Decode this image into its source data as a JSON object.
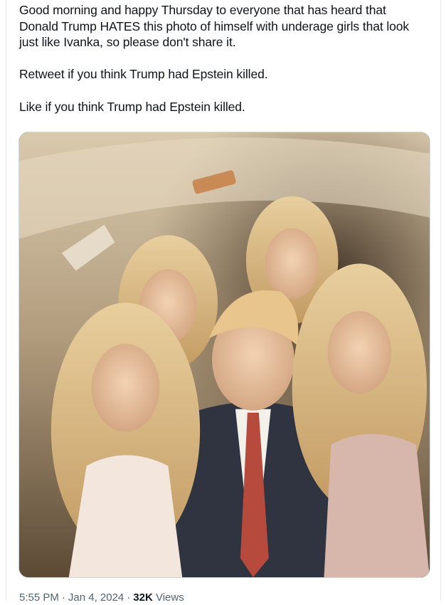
{
  "tweet": {
    "lines": [
      "Good morning and happy Thursday to everyone that has heard that",
      "Donald Trump HATES this photo of himself with underage girls that look",
      "just like Ivanka, so please don't share it."
    ],
    "retweet_line": "Retweet if you think Trump had Epstein killed.",
    "like_line": "Like if you think Trump had Epstein killed.",
    "time": "5:55 PM",
    "separator": "·",
    "date": "Jan 4, 2024",
    "views_count": "32K",
    "views_label": "Views"
  },
  "media": {
    "description_icon": "photo-image"
  },
  "colors": {
    "text": "#0f1419",
    "secondary": "#536471",
    "border": "#cfd9de"
  }
}
